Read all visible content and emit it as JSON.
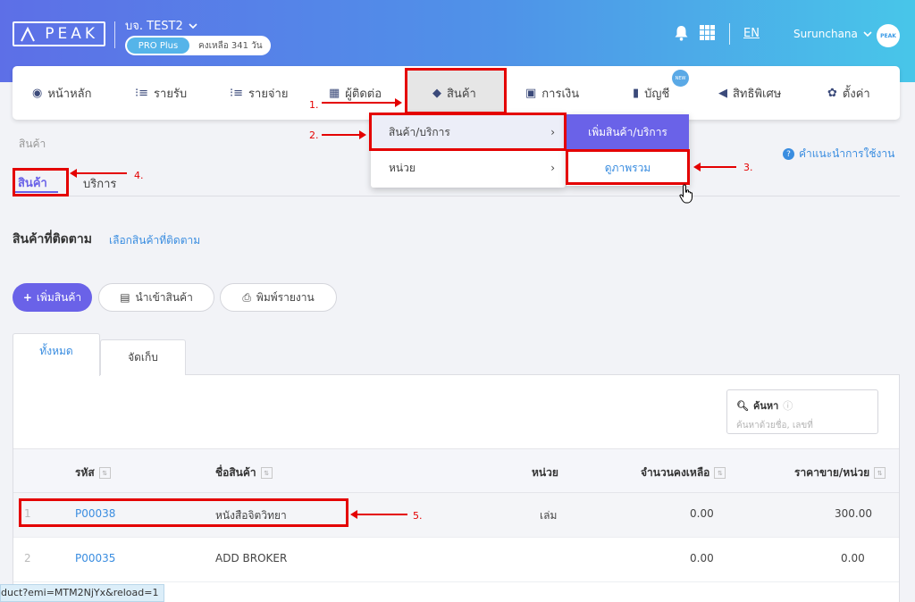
{
  "header": {
    "logo_text": "PEAK",
    "company": "บจ. TEST2",
    "plan": "PRO Plus",
    "remaining": "คงเหลือ 341 วัน",
    "lang": "EN",
    "user": "Surunchana",
    "avatar_text": "PEAK"
  },
  "nav": {
    "items": [
      {
        "label": "หน้าหลัก",
        "icon": "dashboard-icon"
      },
      {
        "label": "รายรับ",
        "icon": "income-list-icon"
      },
      {
        "label": "รายจ่าย",
        "icon": "expense-list-icon"
      },
      {
        "label": "ผู้ติดต่อ",
        "icon": "contacts-icon"
      },
      {
        "label": "สินค้า",
        "icon": "cube-icon"
      },
      {
        "label": "การเงิน",
        "icon": "money-icon"
      },
      {
        "label": "บัญชี",
        "icon": "book-icon"
      },
      {
        "label": "สิทธิพิเศษ",
        "icon": "megaphone-icon"
      },
      {
        "label": "ตั้งค่า",
        "icon": "gear-icon"
      }
    ],
    "new_badge": "NEW",
    "active": "สินค้า"
  },
  "dropdown": {
    "items": [
      {
        "label": "สินค้า/บริการ",
        "chevron": "›"
      },
      {
        "label": "หน่วย",
        "chevron": "›"
      }
    ],
    "submenu": {
      "header": "เพิ่มสินค้า/บริการ",
      "item": "ดูภาพรวม"
    }
  },
  "breadcrumb": "สินค้า",
  "help_link": "คำแนะนำการใช้งาน",
  "page_tabs": [
    "สินค้า",
    "บริการ"
  ],
  "watchlist": {
    "title": "สินค้าที่ติดตาม",
    "link": "เลือกสินค้าที่ติดตาม"
  },
  "actions": {
    "add": "เพิ่มสินค้า",
    "import": "นำเข้าสินค้า",
    "print": "พิมพ์รายงาน"
  },
  "list_tabs": [
    "ทั้งหมด",
    "จัดเก็บ"
  ],
  "search": {
    "label": "ค้นหา",
    "placeholder": "ค้นหาด้วยชื่อ, เลขที่"
  },
  "table": {
    "headers": {
      "code": "รหัส",
      "name": "ชื่อสินค้า",
      "unit": "หน่วย",
      "qty": "จำนวนคงเหลือ",
      "price": "ราคาขาย/หน่วย"
    },
    "rows": [
      {
        "no": "1",
        "code": "P00038",
        "name": "หนังสือจิตวิทยา",
        "unit": "เล่ม",
        "qty": "0.00",
        "price": "300.00"
      },
      {
        "no": "2",
        "code": "P00035",
        "name": "ADD BROKER",
        "unit": "",
        "qty": "0.00",
        "price": "0.00"
      }
    ]
  },
  "status_url": "duct?emi=MTM2NjYx&reload=1",
  "annotations": [
    "1.",
    "2.",
    "3.",
    "4.",
    "5."
  ],
  "colors": {
    "primary": "#6a62e8",
    "link": "#3a8de0",
    "annotation": "#e40000"
  }
}
